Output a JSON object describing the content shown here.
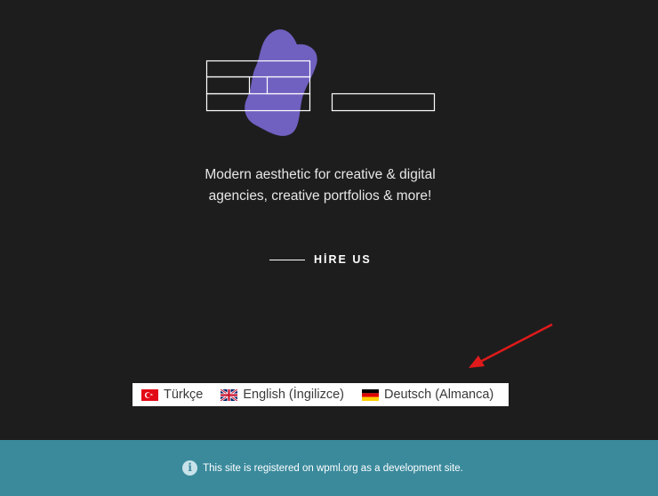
{
  "hero": {
    "tagline_line1": "Modern aesthetic for creative & digital",
    "tagline_line2": "agencies, creative portfolios & more!",
    "cta_label": "HİRE US",
    "accent_color": "#7060c0"
  },
  "language_switcher": {
    "items": [
      {
        "label": "Türkçe",
        "flag": "flag-tr-icon"
      },
      {
        "label": "English (İngilizce)",
        "flag": "flag-gb-icon"
      },
      {
        "label": "Deutsch (Almanca)",
        "flag": "flag-de-icon"
      }
    ]
  },
  "annotation": {
    "arrow_color": "#e01a1a"
  },
  "footer": {
    "notice": "This site is registered on wpml.org as a development site.",
    "icon": "info-icon",
    "background": "#3a8a9c"
  }
}
